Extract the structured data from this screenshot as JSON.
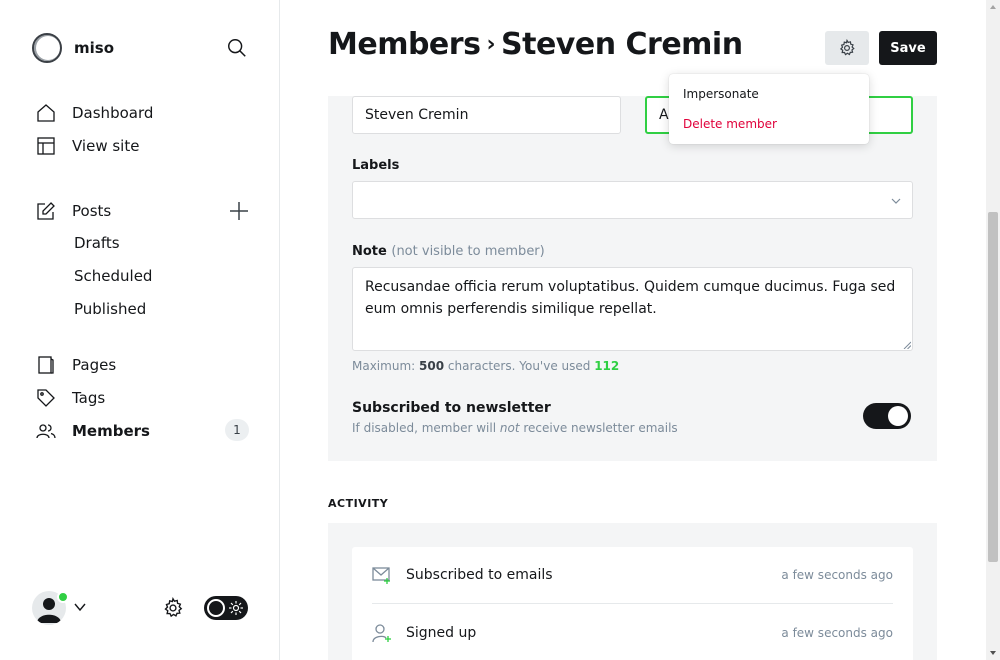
{
  "app": {
    "brand": "miso"
  },
  "sidebar": {
    "nav": [
      {
        "label": "Dashboard",
        "icon": "home-icon"
      },
      {
        "label": "View site",
        "icon": "layout-icon"
      },
      {
        "label": "Posts",
        "icon": "edit-icon"
      },
      {
        "label": "Pages",
        "icon": "page-icon"
      },
      {
        "label": "Tags",
        "icon": "tag-icon"
      },
      {
        "label": "Members",
        "icon": "members-icon",
        "active": true,
        "count": "1"
      }
    ],
    "posts_sub": [
      "Drafts",
      "Scheduled",
      "Published"
    ]
  },
  "header": {
    "breadcrumb_parent": "Members",
    "breadcrumb_separator": "›",
    "title": "Steven Cremin",
    "save_label": "Save"
  },
  "form": {
    "name_value": "Steven Cremin",
    "email_value_visible": "A",
    "labels_label": "Labels",
    "labels_value": "",
    "note_label": "Note",
    "note_hint_label": "(not visible to member)",
    "note_value": "Recusandae officia rerum voluptatibus. Quidem cumque ducimus. Fuga sed eum omnis perferendis similique repellat.",
    "hint_prefix": "Maximum:",
    "hint_max": "500",
    "hint_middle": "characters. You've used",
    "hint_used": "112",
    "newsletter_title": "Subscribed to newsletter",
    "newsletter_desc_before": "If disabled, member will",
    "newsletter_desc_em": "not",
    "newsletter_desc_after": "receive newsletter emails",
    "newsletter_enabled": true
  },
  "dropdown": {
    "impersonate": "Impersonate",
    "delete": "Delete member"
  },
  "activity": {
    "heading": "ACTIVITY",
    "items": [
      {
        "title": "Subscribed to emails",
        "time": "a few seconds ago",
        "icon": "email-subscribe-icon"
      },
      {
        "title": "Signed up",
        "time": "a few seconds ago",
        "icon": "user-add-icon"
      }
    ]
  },
  "colors": {
    "accent_green": "#30cf43",
    "danger_red": "#e0003a",
    "dark": "#15171a"
  }
}
